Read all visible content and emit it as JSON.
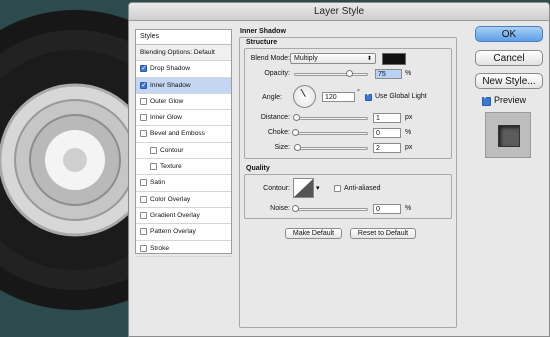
{
  "window": {
    "title": "Layer Style"
  },
  "styles_panel": {
    "header": "Styles",
    "blending_options": "Blending Options: Default",
    "items": [
      {
        "label": "Drop Shadow",
        "checked": true,
        "selected": false,
        "indent": false
      },
      {
        "label": "Inner Shadow",
        "checked": true,
        "selected": true,
        "indent": false
      },
      {
        "label": "Outer Glow",
        "checked": false,
        "selected": false,
        "indent": false
      },
      {
        "label": "Inner Glow",
        "checked": false,
        "selected": false,
        "indent": false
      },
      {
        "label": "Bevel and Emboss",
        "checked": false,
        "selected": false,
        "indent": false
      },
      {
        "label": "Contour",
        "checked": false,
        "selected": false,
        "indent": true
      },
      {
        "label": "Texture",
        "checked": false,
        "selected": false,
        "indent": true
      },
      {
        "label": "Satin",
        "checked": false,
        "selected": false,
        "indent": false
      },
      {
        "label": "Color Overlay",
        "checked": false,
        "selected": false,
        "indent": false
      },
      {
        "label": "Gradient Overlay",
        "checked": false,
        "selected": false,
        "indent": false
      },
      {
        "label": "Pattern Overlay",
        "checked": false,
        "selected": false,
        "indent": false
      },
      {
        "label": "Stroke",
        "checked": false,
        "selected": false,
        "indent": false
      }
    ]
  },
  "inner_shadow": {
    "title": "Inner Shadow",
    "structure": {
      "title": "Structure",
      "blend_mode_label": "Blend Mode:",
      "blend_mode_value": "Multiply",
      "color": "#111111",
      "opacity_label": "Opacity:",
      "opacity_value": "75",
      "opacity_unit": "%",
      "opacity_fraction": 0.75,
      "angle_label": "Angle:",
      "angle_value": "120",
      "angle_unit": "°",
      "use_global_light_label": "Use Global Light",
      "use_global_light": true,
      "distance_label": "Distance:",
      "distance_value": "1",
      "distance_unit": "px",
      "choke_label": "Choke:",
      "choke_value": "0",
      "choke_unit": "%",
      "size_label": "Size:",
      "size_value": "2",
      "size_unit": "px"
    },
    "quality": {
      "title": "Quality",
      "contour_label": "Contour:",
      "anti_aliased_label": "Anti-aliased",
      "anti_aliased": false,
      "noise_label": "Noise:",
      "noise_value": "0",
      "noise_unit": "%"
    },
    "make_default_label": "Make Default",
    "reset_default_label": "Reset to Default"
  },
  "buttons": {
    "ok": "OK",
    "cancel": "Cancel",
    "new_style": "New Style...",
    "preview_label": "Preview",
    "preview_checked": true
  },
  "colors": {
    "accent": "#3a78d8",
    "selected_row": "#c3d6f2",
    "ok_button": "#5d9ee6"
  }
}
